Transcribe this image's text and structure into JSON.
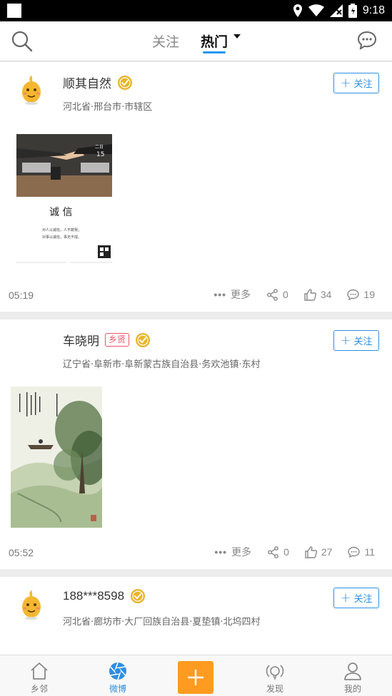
{
  "status_bar": {
    "time": "9:18"
  },
  "top_nav": {
    "tab_follow": "关注",
    "tab_hot": "热门"
  },
  "follow_button_label": "关注",
  "more_label": "更多",
  "posts": [
    {
      "user": "顺其自然",
      "badge": "",
      "location": "河北省·邢台市·市辖区",
      "time": "05:19",
      "shares": "0",
      "likes": "34",
      "comments": "19",
      "image": {
        "date_weekday": "二日",
        "date_day": "15",
        "title": "诚 信",
        "line1": "对人以诚信，人不欺我；",
        "line2": "对事以诚信，事无不成。"
      }
    },
    {
      "user": "车晓明",
      "badge": "乡贤",
      "location": "辽宁省·阜新市·阜新蒙古族自治县·务欢池镇·东村",
      "time": "05:52",
      "shares": "0",
      "likes": "27",
      "comments": "11"
    },
    {
      "user": "188***8598",
      "badge": "",
      "location": "河北省·廊坊市·大厂回族自治县·夏垫镇·北坞四村"
    }
  ],
  "tab_bar": {
    "neighbor": "乡邻",
    "weibo": "微博",
    "discover": "发现",
    "mine": "我的"
  },
  "colors": {
    "accent": "#2f8fe0",
    "tab_underline": "#2196f3",
    "post_button": "#ff9b21",
    "badge": "#e9546b",
    "verified": "#e8b42a"
  }
}
